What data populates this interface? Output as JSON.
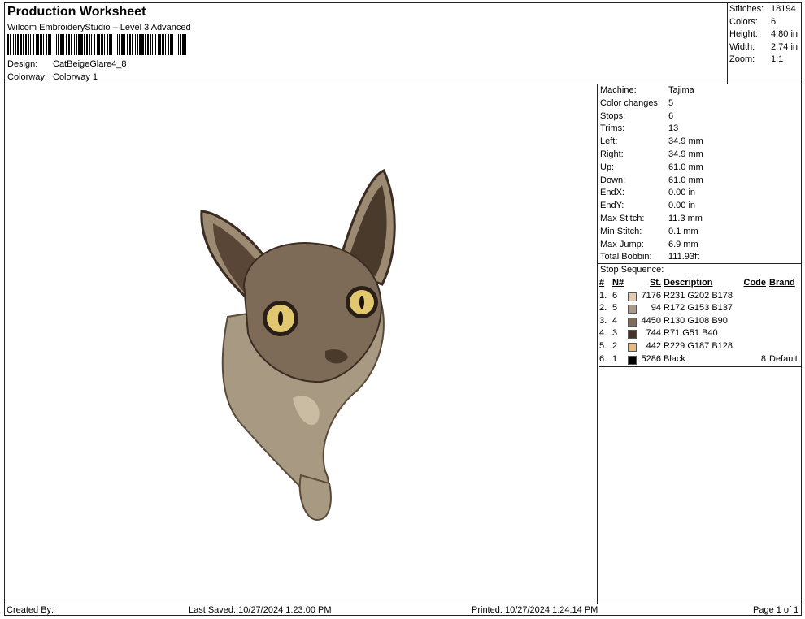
{
  "header": {
    "title": "Production Worksheet",
    "software": "Wilcom EmbroideryStudio – Level 3 Advanced",
    "design_label": "Design:",
    "design_value": "CatBeigeGlare4_8",
    "colorway_label": "Colorway:",
    "colorway_value": "Colorway 1"
  },
  "summary": [
    {
      "label": "Stitches:",
      "value": "18194"
    },
    {
      "label": "Colors:",
      "value": "6"
    },
    {
      "label": "Height:",
      "value": "4.80 in"
    },
    {
      "label": "Width:",
      "value": "2.74 in"
    },
    {
      "label": "Zoom:",
      "value": "1:1"
    }
  ],
  "properties": [
    {
      "label": "Machine:",
      "value": "Tajima"
    },
    {
      "label": "Color changes:",
      "value": "5"
    },
    {
      "label": "Stops:",
      "value": "6"
    },
    {
      "label": "Trims:",
      "value": "13"
    },
    {
      "label": "Left:",
      "value": "34.9 mm"
    },
    {
      "label": "Right:",
      "value": "34.9 mm"
    },
    {
      "label": "Up:",
      "value": "61.0 mm"
    },
    {
      "label": "Down:",
      "value": "61.0 mm"
    },
    {
      "label": "EndX:",
      "value": "0.00 in"
    },
    {
      "label": "EndY:",
      "value": "0.00 in"
    },
    {
      "label": "Max Stitch:",
      "value": "11.3 mm"
    },
    {
      "label": "Min Stitch:",
      "value": "0.1 mm"
    },
    {
      "label": "Max Jump:",
      "value": "6.9 mm"
    },
    {
      "label": "Total Bobbin:",
      "value": "111.93ft"
    }
  ],
  "stop_sequence": {
    "title": "Stop Sequence:",
    "headers": {
      "num": "#",
      "n": "N#",
      "st": "St.",
      "desc": "Description",
      "code": "Code",
      "brand": "Brand"
    },
    "rows": [
      {
        "num": "1.",
        "n": "6",
        "color": "#E7CAB2",
        "st": "7176",
        "desc": "R231 G202 B178",
        "code": "",
        "brand": ""
      },
      {
        "num": "2.",
        "n": "5",
        "color": "#AC9989",
        "st": "94",
        "desc": "R172 G153 B137",
        "code": "",
        "brand": ""
      },
      {
        "num": "3.",
        "n": "4",
        "color": "#826C5A",
        "st": "4450",
        "desc": "R130 G108 B90",
        "code": "",
        "brand": ""
      },
      {
        "num": "4.",
        "n": "3",
        "color": "#473328",
        "st": "744",
        "desc": "R71 G51 B40",
        "code": "",
        "brand": ""
      },
      {
        "num": "5.",
        "n": "2",
        "color": "#E5BB80",
        "st": "442",
        "desc": "R229 G187 B128",
        "code": "",
        "brand": ""
      },
      {
        "num": "6.",
        "n": "1",
        "color": "#000000",
        "st": "5286",
        "desc": "Black",
        "code": "8",
        "brand": "Default"
      }
    ]
  },
  "footer": {
    "created_by": "Created By:",
    "last_saved": "Last Saved: 10/27/2024 1:23:00 PM",
    "printed": "Printed: 10/27/2024 1:24:14 PM",
    "page": "Page 1 of 1"
  }
}
